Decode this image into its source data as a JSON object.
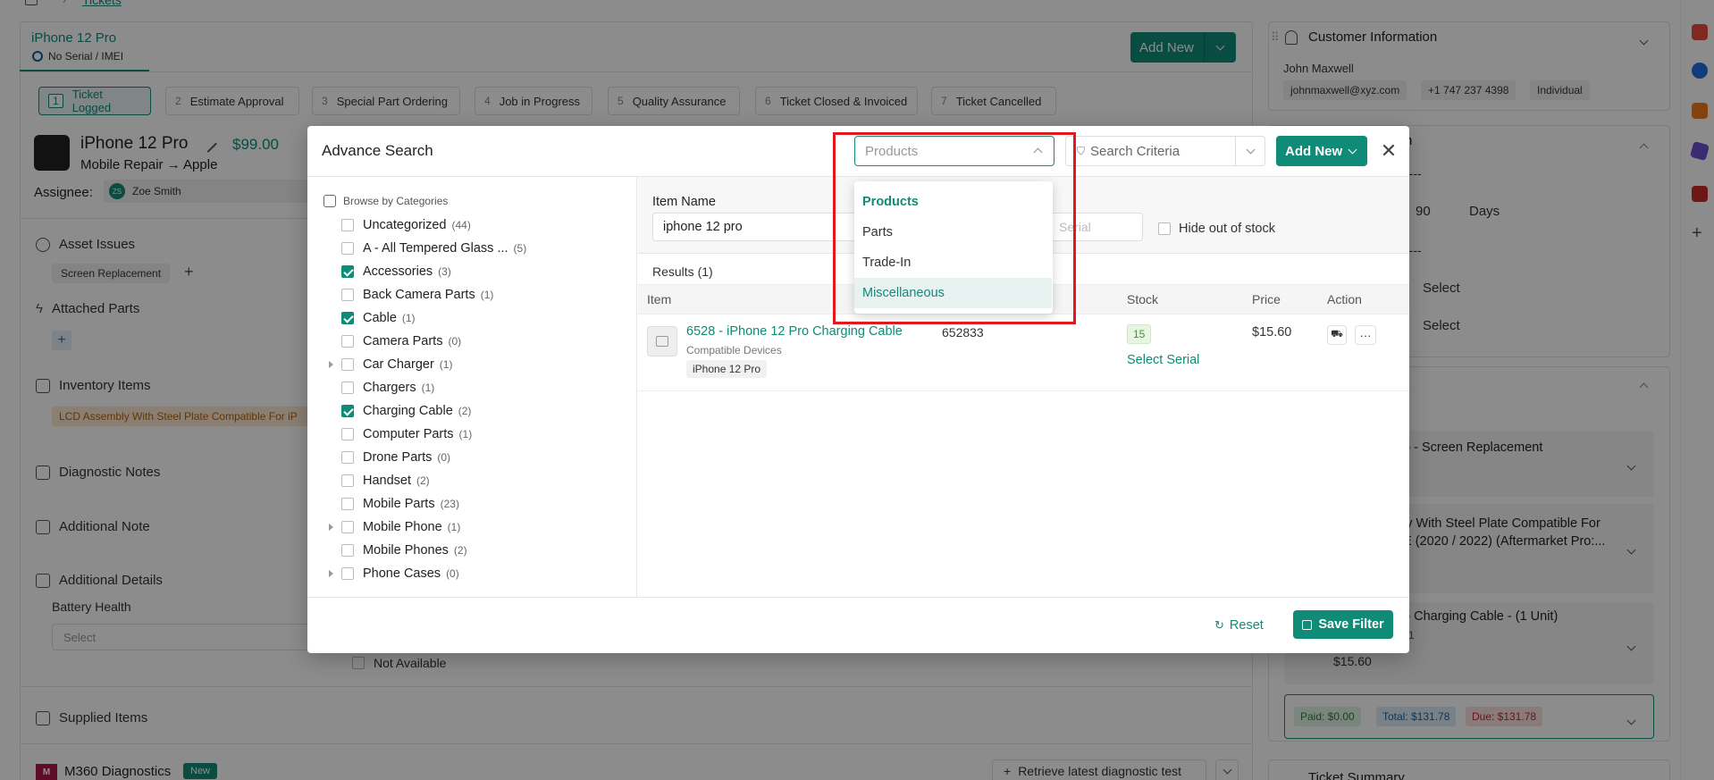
{
  "breadcrumb": {
    "current": "Tickets"
  },
  "ticket": {
    "device_title": "iPhone 12 Pro",
    "serial_note": "No Serial / IMEI",
    "device_name": "iPhone 12 Pro",
    "price": "$99.00",
    "service": "Mobile Repair → Apple",
    "assignee_label": "Assignee:",
    "assignee_initials": "ZS",
    "assignee_name": "Zoe Smith",
    "add_new_label": "Add New"
  },
  "steps": [
    {
      "num": "1",
      "label": "Ticket Logged"
    },
    {
      "num": "2",
      "label": "Estimate Approval"
    },
    {
      "num": "3",
      "label": "Special Part Ordering"
    },
    {
      "num": "4",
      "label": "Job in Progress"
    },
    {
      "num": "5",
      "label": "Quality Assurance"
    },
    {
      "num": "6",
      "label": "Ticket Closed & Invoiced"
    },
    {
      "num": "7",
      "label": "Ticket Cancelled"
    }
  ],
  "sections": {
    "asset_issues": "Asset Issues",
    "asset_issue_tag": "Screen Replacement",
    "attached_parts": "Attached Parts",
    "inventory_items": "Inventory Items",
    "inventory_tag": "LCD Assembly With Steel Plate Compatible For iP",
    "diagnostic_notes": "Diagnostic Notes",
    "additional_note": "Additional Note",
    "additional_details": "Additional Details",
    "battery_health": "Battery Health",
    "battery_select": "Select",
    "not_available": "Not Available",
    "supplied_items": "Supplied Items",
    "diagnostics": "M360 Diagnostics",
    "diagnostics_badge": "New",
    "retrieve_button": "Retrieve latest diagnostic test"
  },
  "customer": {
    "header": "Customer Information",
    "name": "John Maxwell",
    "email": "johnmaxwell@xyz.com",
    "phone": "+1 747 237 4398",
    "type": "Individual"
  },
  "right_panel": {
    "partial_header": "n",
    "dash1": "----",
    "days_value": "90",
    "days_label": "Days",
    "dash2": "----",
    "select1": "Select",
    "select2": "Select",
    "item1": "o - Screen Replacement",
    "item2_line1": "ly With Steel Plate Compatible For",
    "item2_line2": "E (2020 / 2022) (Aftermarket Pro:...",
    "item3": "o Charging Cable - (1 Unit)",
    "item3_sub": "1",
    "item3_price": "$15.60",
    "paid": "Paid: $0.00",
    "total": "Total: $131.78",
    "due": "Due: $131.78",
    "ticket_summary": "Ticket Summary"
  },
  "modal": {
    "title": "Advance Search",
    "type_select_placeholder": "Products",
    "search_criteria_placeholder": "Search Criteria",
    "add_new": "Add New",
    "browse_label": "Browse by Categories",
    "categories": [
      {
        "label": "Uncategorized",
        "count": "(44)",
        "checked": false,
        "expandable": false
      },
      {
        "label": "A - All Tempered Glass ...",
        "count": "(5)",
        "checked": false,
        "expandable": false
      },
      {
        "label": "Accessories",
        "count": "(3)",
        "checked": true,
        "expandable": false
      },
      {
        "label": "Back Camera Parts",
        "count": "(1)",
        "checked": false,
        "expandable": false
      },
      {
        "label": "Cable",
        "count": "(1)",
        "checked": true,
        "expandable": false
      },
      {
        "label": "Camera Parts",
        "count": "(0)",
        "checked": false,
        "expandable": false
      },
      {
        "label": "Car Charger",
        "count": "(1)",
        "checked": false,
        "expandable": true
      },
      {
        "label": "Chargers",
        "count": "(1)",
        "checked": false,
        "expandable": false
      },
      {
        "label": "Charging Cable",
        "count": "(2)",
        "checked": true,
        "expandable": false
      },
      {
        "label": "Computer Parts",
        "count": "(1)",
        "checked": false,
        "expandable": false
      },
      {
        "label": "Drone Parts",
        "count": "(0)",
        "checked": false,
        "expandable": false
      },
      {
        "label": "Handset",
        "count": "(2)",
        "checked": false,
        "expandable": false
      },
      {
        "label": "Mobile Parts",
        "count": "(23)",
        "checked": false,
        "expandable": false
      },
      {
        "label": "Mobile Phone",
        "count": "(1)",
        "checked": false,
        "expandable": true
      },
      {
        "label": "Mobile Phones",
        "count": "(2)",
        "checked": false,
        "expandable": false
      },
      {
        "label": "Phone Cases",
        "count": "(0)",
        "checked": false,
        "expandable": true
      }
    ],
    "item_name_label": "Item Name",
    "item_name_value": "iphone 12 pro",
    "serial_placeholder": "Serial",
    "hide_out_of_stock": "Hide out of stock",
    "results_label": "Results (1)",
    "columns": {
      "item": "Item",
      "stock": "Stock",
      "price": "Price",
      "action": "Action"
    },
    "result": {
      "title": "6528 - iPhone 12 Pro Charging Cable",
      "compatible_label": "Compatible Devices",
      "device_tag": "iPhone 12 Pro",
      "sku": "652833",
      "stock": "15",
      "select_serial": "Select Serial",
      "price": "$15.60"
    },
    "reset": "Reset",
    "save_filter": "Save Filter",
    "dropdown": {
      "options": [
        "Products",
        "Parts",
        "Trade-In",
        "Miscellaneous"
      ],
      "selected": "Products",
      "hovered": "Miscellaneous"
    }
  },
  "colors": {
    "accent": "#0f8b78",
    "highlight_box": "#e0191e",
    "overlay": "rgba(0,0,0,0.45)"
  }
}
